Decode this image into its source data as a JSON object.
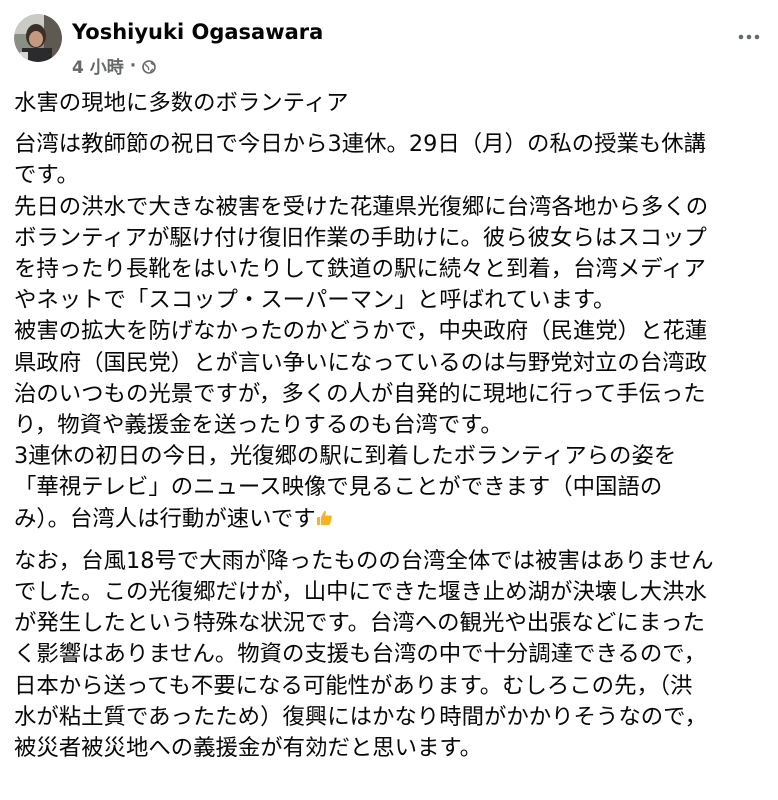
{
  "post": {
    "author": "Yoshiyuki Ogasawara",
    "time": "4 小時",
    "separator": "·",
    "audience_icon": "globe-icon",
    "menu_icon": "more-horizontal-icon",
    "title_line": "水害の現地に多数のボランティア",
    "paragraphs": [
      [
        "台湾は教師節の祝日で今日から3連休。29日（月）の私の授業も休講",
        "です。",
        "先日の洪水で大きな被害を受けた花蓮県光復郷に台湾各地から多くの",
        "ボランティアが駆け付け復旧作業の手助けに。彼ら彼女らはスコップ",
        "を持ったり長靴をはいたりして鉄道の駅に続々と到着，台湾メディア",
        "やネットで「スコップ・スーパーマン」と呼ばれています。",
        "被害の拡大を防げなかったのかどうかで，中央政府（民進党）と花蓮",
        "県政府（国民党）とが言い争いになっているのは与野党対立の台湾政",
        "治のいつもの光景ですが，多くの人が自発的に現地に行って手伝った",
        "り，物資や義援金を送ったりするのも台湾です。",
        "3連休の初日の今日，光復郷の駅に到着したボランティアらの姿を",
        "「華視テレビ」のニュース映像で見ることができます（中国語の",
        "み）。台湾人は行動が速いです"
      ],
      [
        "なお，台風18号で大雨が降ったものの台湾全体では被害はありません",
        "でした。この光復郷だけが，山中にできた堰き止め湖が決壊し大洪水",
        "が発生したという特殊な状況です。台湾への観光や出張などにまった",
        "く影響はありません。物資の支援も台湾の中で十分調達できるので，",
        "日本から送っても不要になる可能性があります。むしろこの先，（洪",
        "水が粘土質であったため）復興にはかなり時間がかかりそうなので，",
        "被災者被災地への義援金が有効だと思います。"
      ]
    ],
    "emoji_after_line": "thumbs-up-emoji",
    "colors": {
      "text": "#080809",
      "secondary": "#65676b",
      "emoji": "#f7b125"
    }
  }
}
